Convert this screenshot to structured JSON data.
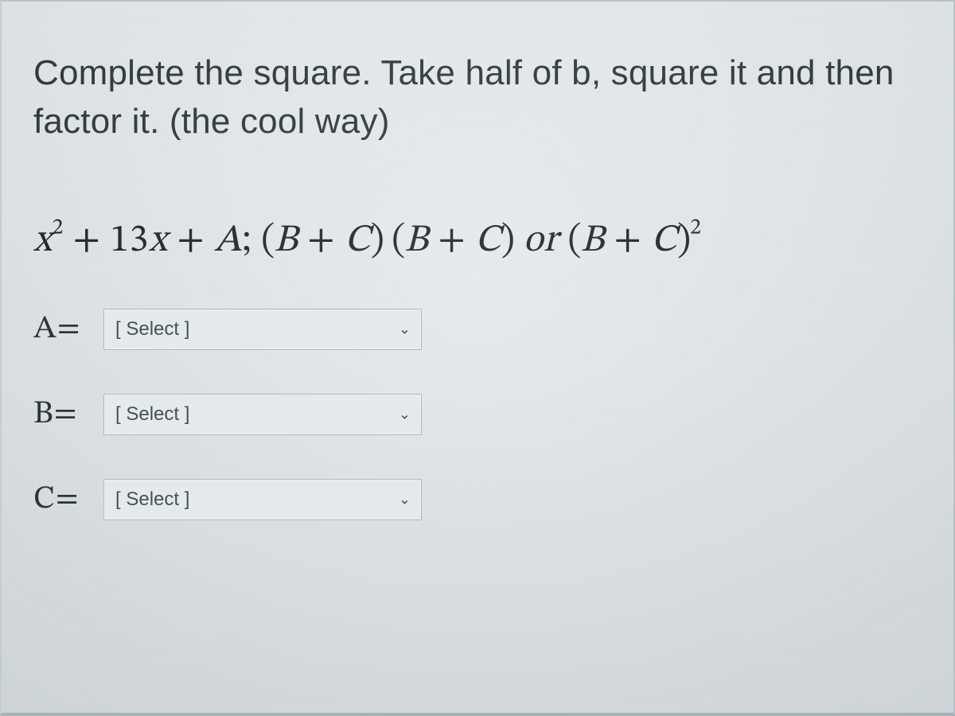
{
  "prompt_text": "Complete the square. Take half of b, square it and then factor it. (the cool way)",
  "equation": {
    "lhs_var": "x",
    "lhs_sq": "2",
    "plus1": " + ",
    "coef": "13",
    "xvar": "x",
    "plus2": " + ",
    "A": "A",
    "semicolon": "; ",
    "lp1": "(",
    "B1": "B",
    "plus3": " + ",
    "C1": "C",
    "rp1": ")",
    "lp2": " (",
    "B2": "B",
    "plus4": " + ",
    "C2": "C",
    "rp2": ")",
    "or": " or ",
    "lp3": "(",
    "B3": "B",
    "plus5": " + ",
    "C3": "C",
    "rp3": ")",
    "sq2": "2"
  },
  "answers": [
    {
      "label": "A=",
      "placeholder": "[ Select ]"
    },
    {
      "label": "B=",
      "placeholder": "[ Select ]"
    },
    {
      "label": "C=",
      "placeholder": "[ Select ]"
    }
  ],
  "icons": {
    "chevron_down": "⌄"
  }
}
